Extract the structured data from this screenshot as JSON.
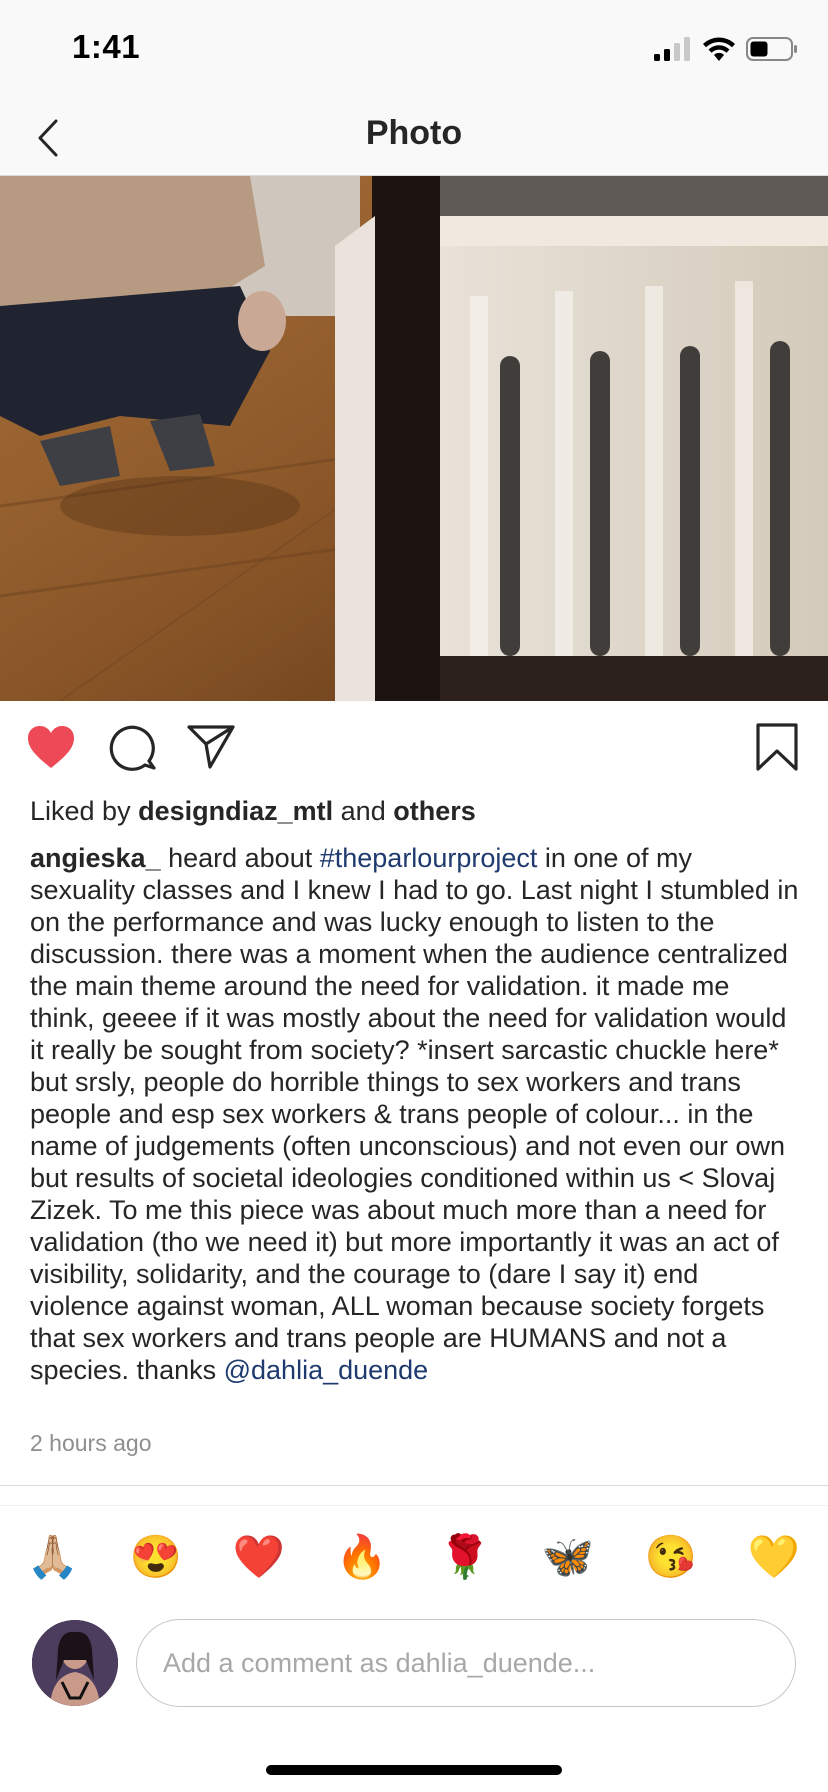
{
  "status_bar": {
    "time": "1:41",
    "icons": [
      "cellular-signal-icon",
      "wifi-icon",
      "battery-icon"
    ]
  },
  "nav": {
    "title": "Photo",
    "back_icon": "chevron-left-icon"
  },
  "post": {
    "actions": {
      "liked": true,
      "icons": [
        "heart-icon",
        "comment-icon",
        "share-icon",
        "bookmark-icon"
      ]
    },
    "likes": {
      "prefix": "Liked by",
      "user": "designdiaz_mtl",
      "middle": "and",
      "suffix": "others"
    },
    "caption": {
      "username": "angieska_",
      "text_1": " heard about ",
      "hashtag": "#theparlourproject",
      "text_2": " in one of my sexuality classes and I knew I had to go. Last night I stumbled in on the performance and was lucky enough to listen to the discussion. there was a moment when the audience centralized the main theme around the need for validation. it made me think, geeee if it was mostly about the need for validation would it really be sought from society? *insert sarcastic chuckle here* but srsly, people do horrible things to sex workers and trans people and esp sex workers & trans people of colour... in the name of judgements (often unconscious) and not even our own but results of societal ideologies conditioned within us < Slovaj Zizek. To me this piece was about much more than a need for validation (tho we need it) but more importantly it was an act of visibility, solidarity, and the courage to (dare I say it) end violence against woman, ALL woman because society forgets that sex workers and trans people are HUMANS and not a species. thanks ",
      "mention": "@dahlia_duende"
    },
    "timestamp": "2 hours ago"
  },
  "quick_reactions": [
    "🙏🏼",
    "😍",
    "❤️",
    "🔥",
    "🌹",
    "🦋",
    "😘",
    "💛"
  ],
  "comment": {
    "placeholder": "Add a comment as dahlia_duende...",
    "value": ""
  },
  "colors": {
    "like_red": "#ed4956",
    "link_blue": "#1e3a6e",
    "text": "#262626",
    "muted": "#8e8e8e"
  }
}
